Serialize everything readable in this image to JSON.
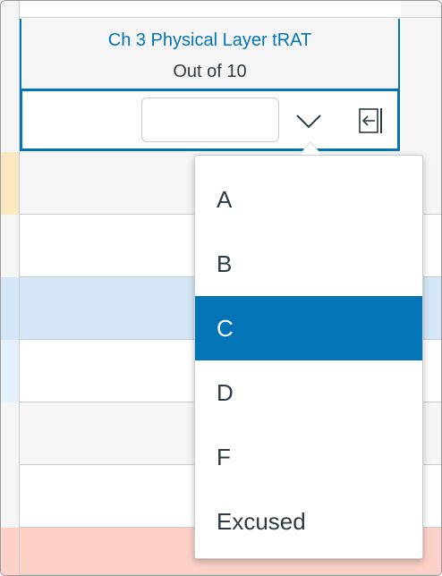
{
  "column_header": {
    "title": "Ch 3 Physical Layer tRAT",
    "points": "Out of 10"
  },
  "grade_cell": {
    "input_value": "",
    "input_placeholder": ""
  },
  "grade_menu": {
    "options": [
      {
        "label": "A",
        "selected": false
      },
      {
        "label": "B",
        "selected": false
      },
      {
        "label": "C",
        "selected": true
      },
      {
        "label": "D",
        "selected": false
      },
      {
        "label": "F",
        "selected": false
      },
      {
        "label": "Excused",
        "selected": false
      }
    ]
  },
  "colors": {
    "accent": "#0374b5",
    "text": "#2d3b45",
    "row_gray": "#f5f5f5",
    "row_blue": "#d5e7f7",
    "row_salmon": "#fcd1c8",
    "row_yellow": "#fbe7c0"
  },
  "icons": {
    "dropdown": "chevron-down-icon",
    "detail_tray": "arrow-open-start-icon"
  }
}
